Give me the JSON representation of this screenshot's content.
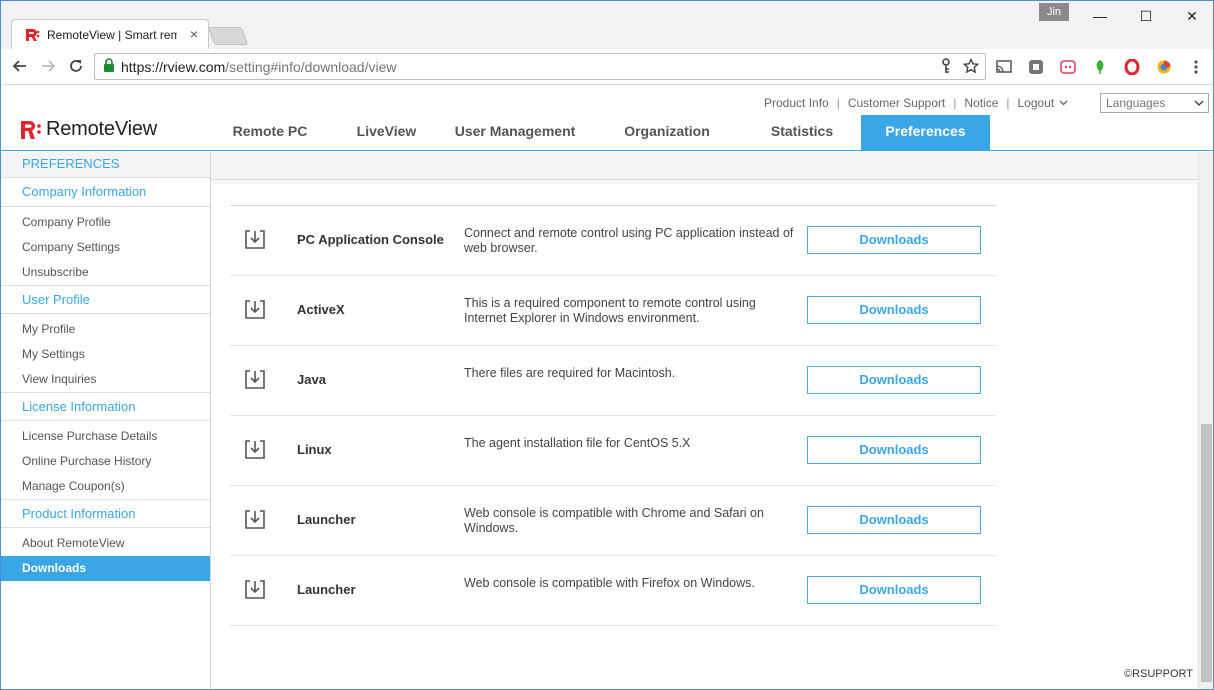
{
  "browser": {
    "tab_title": "RemoteView | Smart rem",
    "tab_close": "×",
    "user_badge": "Jin",
    "url_host": "https://rview.com",
    "url_path": "/setting#info/download/view",
    "minimize": "—",
    "maximize": "☐",
    "close": "✕"
  },
  "header": {
    "logo_text": "RemoteView",
    "util_links": [
      "Product Info",
      "Customer Support",
      "Notice",
      "Logout"
    ],
    "separator": "|",
    "languages_placeholder": "Languages",
    "nav": [
      {
        "label": "Remote PC",
        "active": false
      },
      {
        "label": "LiveView",
        "active": false
      },
      {
        "label": "User Management",
        "active": false
      },
      {
        "label": "Organization",
        "active": false
      },
      {
        "label": "Statistics",
        "active": false
      },
      {
        "label": "Preferences",
        "active": true
      }
    ]
  },
  "sidebar": {
    "title": "PREFERENCES",
    "groups": [
      {
        "label": "Company Information",
        "items": [
          {
            "label": "Company Profile"
          },
          {
            "label": "Company Settings"
          },
          {
            "label": "Unsubscribe"
          }
        ]
      },
      {
        "label": "User Profile",
        "items": [
          {
            "label": "My Profile"
          },
          {
            "label": "My Settings"
          },
          {
            "label": "View Inquiries"
          }
        ]
      },
      {
        "label": "License Information",
        "items": [
          {
            "label": "License Purchase Details"
          },
          {
            "label": "Online Purchase History"
          },
          {
            "label": "Manage Coupon(s)"
          }
        ]
      },
      {
        "label": "Product Information",
        "items": [
          {
            "label": "About RemoteView"
          },
          {
            "label": "Downloads",
            "active": true
          }
        ]
      }
    ]
  },
  "downloads": {
    "button_label": "Downloads",
    "rows": [
      {
        "name": "PC Application Console",
        "description": "Connect and remote control using PC application instead of web browser."
      },
      {
        "name": "ActiveX",
        "description": "This is a required component to remote control using Internet Explorer in Windows environment."
      },
      {
        "name": "Java",
        "description": "There files are required for Macintosh."
      },
      {
        "name": "Linux",
        "description": "The agent installation file for CentOS 5.X"
      },
      {
        "name": "Launcher",
        "description": "Web console is compatible with Chrome and Safari on Windows."
      },
      {
        "name": "Launcher",
        "description": "Web console is compatible with Firefox on Windows."
      }
    ]
  },
  "footer": {
    "copyright": "©RSUPPORT"
  },
  "colors": {
    "accent": "#3ba6e6",
    "logo_red": "#e0262d"
  }
}
